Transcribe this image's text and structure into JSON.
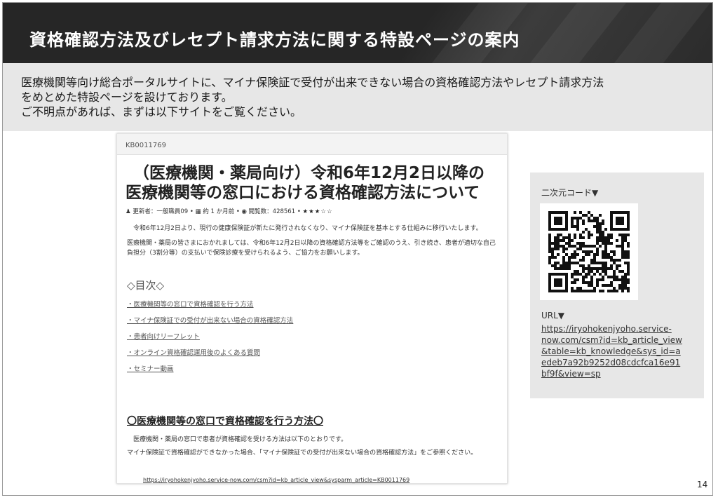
{
  "slide": {
    "title": "資格確認方法及びレセプト請求方法に関する特設ページの案内",
    "intro_lines": [
      "医療機関等向け総合ポータルサイトに、マイナ保険証で受付が出来できない場合の資格確認方法やレセプト請求方法",
      "をめとめた特設ページを設けております。",
      "ご不明点があれば、まずは以下サイトをご覧ください。"
    ],
    "page_number": "14"
  },
  "article": {
    "kb_id": "KB0011769",
    "title_lines": [
      "（医療機関・薬局向け）令和6年12月2日以降の",
      "医療機関等の窓口における資格確認方法について"
    ],
    "meta": {
      "author": "更新者：一般職員09",
      "date": "約 1 か月前",
      "views": "閲覧数：428561",
      "rating": "★★★☆☆"
    },
    "paragraphs": [
      "令和6年12月2日より、現行の健康保険証が新たに発行されなくなり、マイナ保険証を基本とする仕組みに移行いたします。",
      "医療機関・薬局の皆さまにおかれましては、令和6年12月2日以降の資格確認方法等をご確認のうえ、引き続き、患者が適切な自己負担分（3割分等）の支払いで保険診療を受けられるよう、ご協力をお願いします。"
    ],
    "toc_heading": "◇目次◇",
    "toc_items": [
      "・医療機関等の窓口で資格確認を行う方法",
      "・マイナ保険証での受付が出来ない場合の資格確認方法",
      "・患者向けリーフレット",
      "・オンライン資格確認運用後のよくある質問",
      "・セミナー動画"
    ],
    "section_heading": "〇医療機関等の窓口で資格確認を行う方法〇",
    "section_paragraphs": [
      "医療機関・薬局の窓口で患者が資格確認を受ける方法は以下のとおりです。",
      "マイナ保険証で資格確認ができなかった場合、「マイナ保険証での受付が出来ない場合の資格確認方法」をご参照ください。"
    ],
    "url": "https://iryohokenjyoho.service-now.com/csm?id=kb_article_view&sysparm_article=KB0011769"
  },
  "side_panel": {
    "qr_label": "二次元コード▼",
    "url_label": "URL▼",
    "url_lines": [
      "https://iryohokenjyoho.service-",
      "now.com/csm?id=kb_article_view",
      "&table=kb_knowledge&sys_id=a",
      "edeb7a92b9252d08cdcfca16e91",
      "bf9f&view=sp"
    ]
  }
}
